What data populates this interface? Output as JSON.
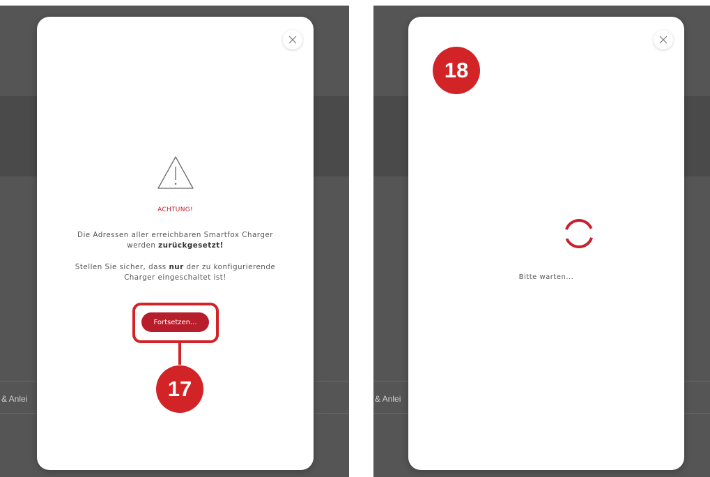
{
  "background": {
    "sidebar_text": "& Anlei"
  },
  "left_dialog": {
    "warning_title": "ACHTUNG!",
    "message1_line1": "Die Adressen aller erreichbaren Smartfox Charger",
    "message1_line2_pre": "werden ",
    "message1_line2_bold": "zurückgesetzt!",
    "message2_line1_pre": "Stellen Sie sicher, dass ",
    "message2_line1_bold": "nur",
    "message2_line1_post": " der zu konfigurierende",
    "message2_line2": "Charger eingeschaltet ist!",
    "continue_label": "Fortsetzen...",
    "close_icon": "close-icon",
    "warning_icon": "warning-triangle-icon"
  },
  "right_dialog": {
    "wait_text": "Bitte warten...",
    "close_icon": "close-icon",
    "spinner_icon": "loading-spinner-icon"
  },
  "annotations": {
    "step_left": "17",
    "step_right": "18"
  },
  "colors": {
    "accent": "#d22327",
    "button": "#b81d2b",
    "overlay": "#555555"
  }
}
